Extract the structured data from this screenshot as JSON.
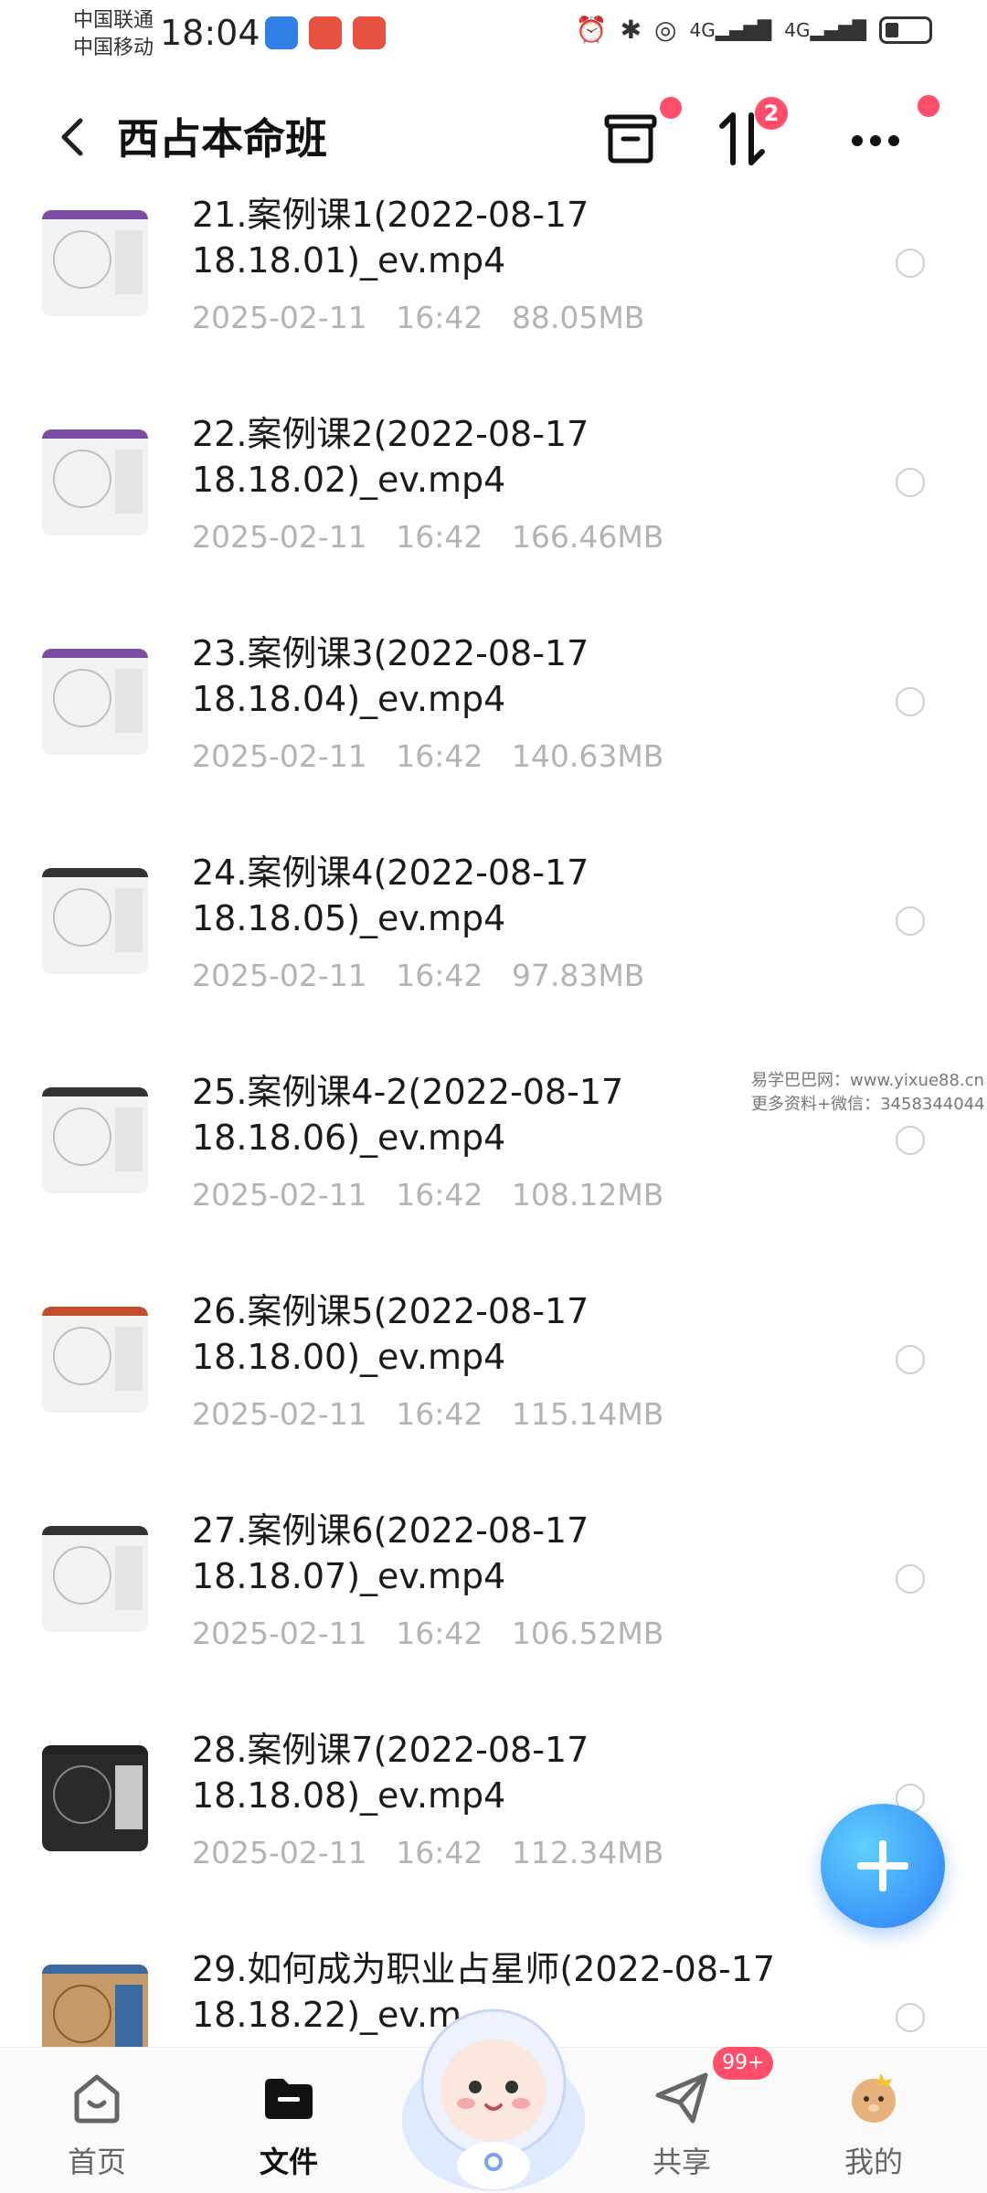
{
  "status_bar": {
    "carrier_1": "中国联通",
    "carrier_2": "中国移动",
    "time": "18:04",
    "signal_label_1": "4G",
    "signal_label_2": "4G"
  },
  "header": {
    "title": "西占本命班",
    "sort_badge": "2"
  },
  "files": [
    {
      "name": "21.案例课1(2022-08-17 18.18.01)_ev.mp4",
      "date": "2025-02-11",
      "time": "16:42",
      "size": "88.05MB",
      "thumb": "light",
      "accent": "#7a4ea3"
    },
    {
      "name": "22.案例课2(2022-08-17 18.18.02)_ev.mp4",
      "date": "2025-02-11",
      "time": "16:42",
      "size": "166.46MB",
      "thumb": "light",
      "accent": "#7a4ea3"
    },
    {
      "name": "23.案例课3(2022-08-17 18.18.04)_ev.mp4",
      "date": "2025-02-11",
      "time": "16:42",
      "size": "140.63MB",
      "thumb": "light",
      "accent": "#7a4ea3"
    },
    {
      "name": "24.案例课4(2022-08-17 18.18.05)_ev.mp4",
      "date": "2025-02-11",
      "time": "16:42",
      "size": "97.83MB",
      "thumb": "light",
      "accent": "#333333"
    },
    {
      "name": "25.案例课4-2(2022-08-17 18.18.06)_ev.mp4",
      "date": "2025-02-11",
      "time": "16:42",
      "size": "108.12MB",
      "thumb": "light",
      "accent": "#333333"
    },
    {
      "name": "26.案例课5(2022-08-17 18.18.00)_ev.mp4",
      "date": "2025-02-11",
      "time": "16:42",
      "size": "115.14MB",
      "thumb": "light",
      "accent": "#c0502a"
    },
    {
      "name": "27.案例课6(2022-08-17 18.18.07)_ev.mp4",
      "date": "2025-02-11",
      "time": "16:42",
      "size": "106.52MB",
      "thumb": "light",
      "accent": "#333333"
    },
    {
      "name": "28.案例课7(2022-08-17 18.18.08)_ev.mp4",
      "date": "2025-02-11",
      "time": "16:42",
      "size": "112.34MB",
      "thumb": "dark",
      "accent": "#222222"
    },
    {
      "name": "29.如何成为职业占星师(2022-08-17 18.18.22)_ev.m",
      "date": "",
      "time": "",
      "size": "",
      "thumb": "light",
      "accent": "#3a6aa0"
    }
  ],
  "watermark": {
    "line_1": "易学巴巴网：www.yixue88.cn",
    "line_2": "更多资料+微信：3458344044"
  },
  "bottom_nav": {
    "home": "首页",
    "files": "文件",
    "share": "共享",
    "share_badge": "99+",
    "mine": "我的"
  },
  "colors": {
    "accent_blue": "#2c7cf6",
    "badge_red": "#ff4d6a",
    "meta_gray": "#b3b3b3"
  }
}
